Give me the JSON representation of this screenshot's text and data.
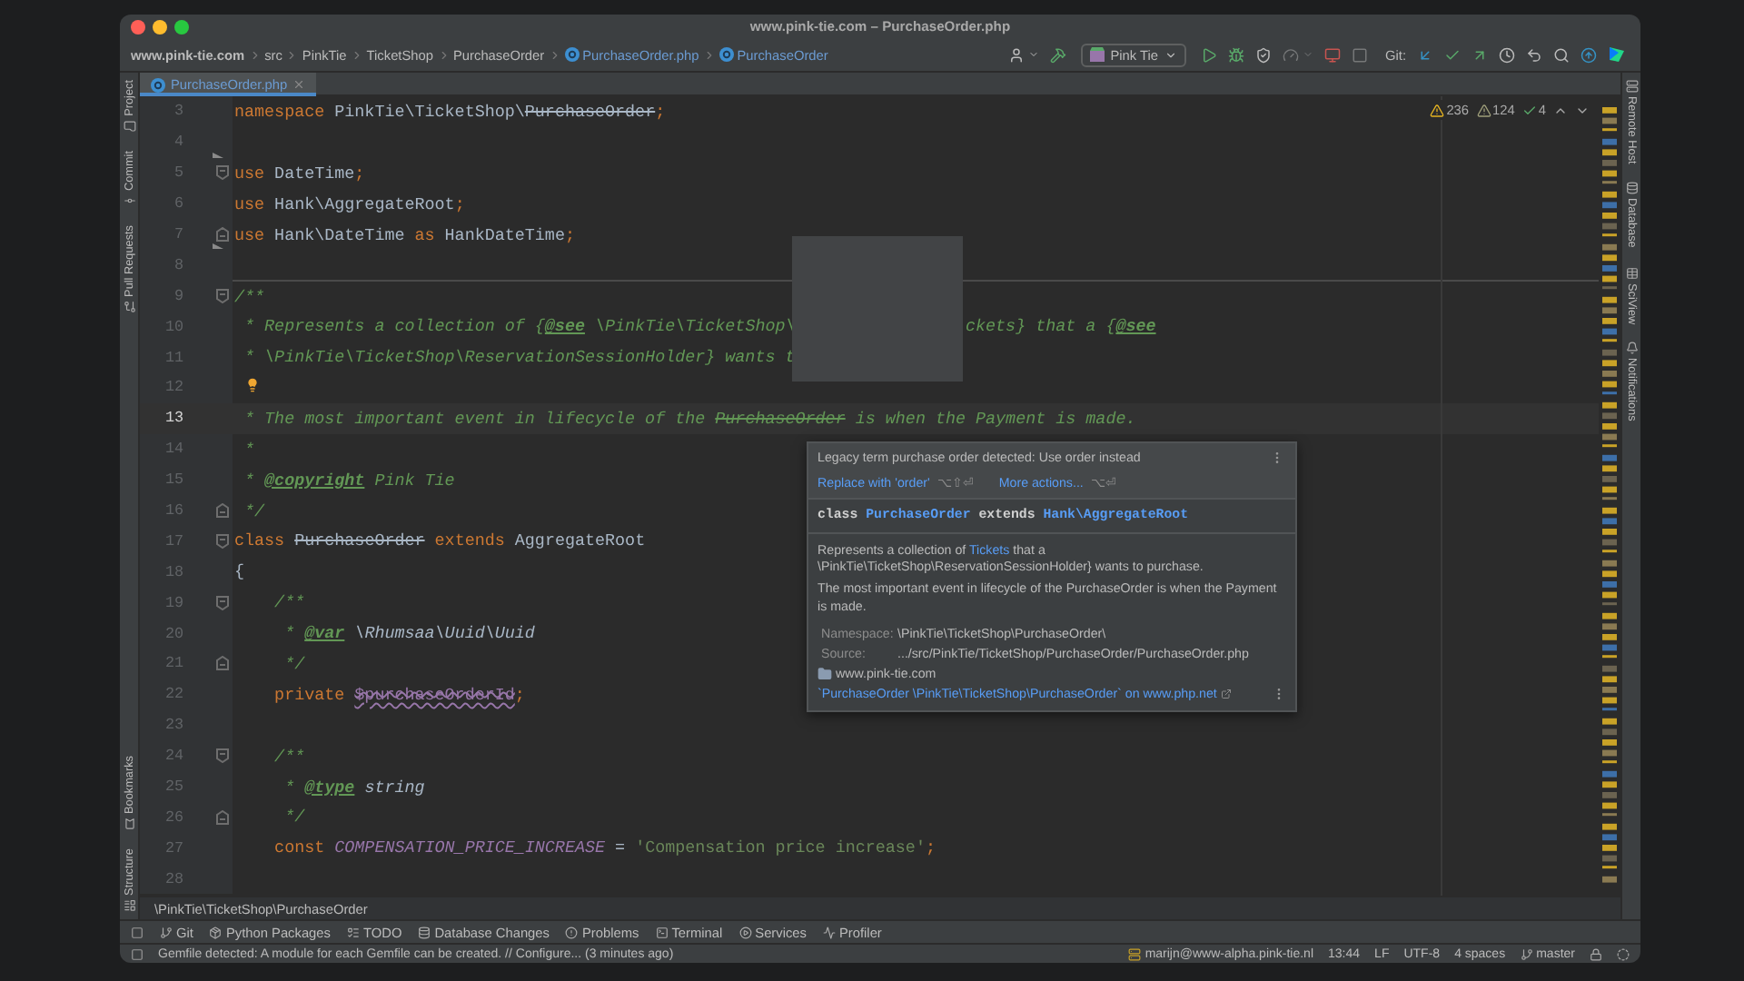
{
  "window": {
    "title": "www.pink-tie.com – PurchaseOrder.php"
  },
  "breadcrumbs": [
    {
      "label": "www.pink-tie.com",
      "kind": "project"
    },
    {
      "label": "src",
      "kind": "folder"
    },
    {
      "label": "PinkTie",
      "kind": "folder"
    },
    {
      "label": "TicketShop",
      "kind": "folder"
    },
    {
      "label": "PurchaseOrder",
      "kind": "folder"
    },
    {
      "label": "PurchaseOrder.php",
      "kind": "class"
    },
    {
      "label": "PurchaseOrder",
      "kind": "class"
    }
  ],
  "toolbar": [
    {
      "kind": "user",
      "disabled": false
    },
    {
      "kind": "build",
      "disabled": false
    },
    {
      "kind": "config",
      "label": "Pink Tie",
      "disabled": false
    },
    {
      "kind": "run",
      "disabled": false
    },
    {
      "kind": "debug",
      "disabled": false
    },
    {
      "kind": "coverage",
      "disabled": false
    },
    {
      "kind": "profile",
      "disabled": true
    },
    {
      "kind": "attach",
      "disabled": false
    },
    {
      "kind": "stop",
      "disabled": true
    },
    {
      "kind": "label",
      "label": "Git:",
      "disabled": false
    },
    {
      "kind": "update",
      "disabled": false
    },
    {
      "kind": "commit",
      "disabled": false
    },
    {
      "kind": "push",
      "disabled": false
    },
    {
      "kind": "history",
      "disabled": false
    },
    {
      "kind": "rollback",
      "disabled": false
    },
    {
      "kind": "search",
      "disabled": false
    },
    {
      "kind": "ide_update",
      "disabled": false
    },
    {
      "kind": "plugin",
      "disabled": false
    }
  ],
  "tabs": [
    {
      "label": "PurchaseOrder.php",
      "selected": true
    }
  ],
  "left_tool_windows": {
    "top": [
      {
        "label": "Project",
        "kind": "project"
      },
      {
        "label": "Commit",
        "kind": "commit"
      },
      {
        "label": "Pull Requests",
        "kind": "pulls"
      }
    ],
    "bottom": [
      {
        "label": "Bookmarks",
        "kind": "bookmarks"
      },
      {
        "label": "Structure",
        "kind": "structure"
      }
    ]
  },
  "right_tool_windows": [
    {
      "label": "Remote Host",
      "kind": "remote"
    },
    {
      "label": "Database",
      "kind": "database"
    },
    {
      "label": "SciView",
      "kind": "sciview"
    },
    {
      "label": "Notifications",
      "kind": "notifications"
    }
  ],
  "inspections": [
    {
      "kind": "warning",
      "count": "236"
    },
    {
      "kind": "weak",
      "count": "124"
    },
    {
      "kind": "typo",
      "count": "4"
    }
  ],
  "code": {
    "lines": [
      {
        "number": "3",
        "tokens": [
          {
            "kind": "kw",
            "text": "namespace"
          },
          {
            "kind": "plain",
            "text": " PinkTie\\TicketShop\\"
          },
          {
            "kind": "strike",
            "text": "PurchaseOrder"
          },
          {
            "kind": "kw",
            "text": ";"
          }
        ]
      },
      {
        "number": "4",
        "marker": true
      },
      {
        "number": "5",
        "fold_start": true,
        "tokens": [
          {
            "kind": "kw",
            "text": "use"
          },
          {
            "kind": "plain",
            "text": " DateTime"
          },
          {
            "kind": "kw",
            "text": ";"
          }
        ]
      },
      {
        "number": "6",
        "tokens": [
          {
            "kind": "kw",
            "text": "use"
          },
          {
            "kind": "plain",
            "text": " Hank\\AggregateRoot"
          },
          {
            "kind": "kw",
            "text": ";"
          }
        ]
      },
      {
        "number": "7",
        "fold_end": true,
        "marker": true,
        "tokens": [
          {
            "kind": "kw",
            "text": "use"
          },
          {
            "kind": "plain",
            "text": " Hank\\DateTime "
          },
          {
            "kind": "kw",
            "text": "as"
          },
          {
            "kind": "plain",
            "text": " HankDateTime"
          },
          {
            "kind": "kw",
            "text": ";"
          }
        ]
      },
      {
        "number": "8"
      },
      {
        "number": "9",
        "fold_start": true,
        "separator_above": true,
        "tokens": [
          {
            "kind": "comment",
            "text": "/**"
          }
        ]
      },
      {
        "number": "10",
        "tokens": [
          {
            "kind": "comment",
            "text": " * Represents a collection of {"
          },
          {
            "kind": "doctag",
            "text": "@see"
          },
          {
            "kind": "comment",
            "text": " \\PinkTie\\TicketShop\\"
          },
          {
            "kind": "covered"
          },
          {
            "kind": "comment",
            "text": "ckets} that a {"
          },
          {
            "kind": "doctag",
            "text": "@see"
          }
        ]
      },
      {
        "number": "11",
        "tokens": [
          {
            "kind": "comment",
            "text": " * \\PinkTie\\TicketShop\\ReservationSessionHolder} wants t"
          }
        ]
      },
      {
        "number": "12",
        "bulb": true
      },
      {
        "number": "13",
        "current": true,
        "tokens": [
          {
            "kind": "comment",
            "text": " * The most important event in lifecycle of the "
          },
          {
            "kind": "commentstrike",
            "text": "PurchaseOrder"
          },
          {
            "kind": "comment",
            "text": " is when the Payment is made."
          }
        ]
      },
      {
        "number": "14",
        "tokens": [
          {
            "kind": "comment",
            "text": " *"
          }
        ]
      },
      {
        "number": "15",
        "tokens": [
          {
            "kind": "comment",
            "text": " * "
          },
          {
            "kind": "doctag",
            "text": "@copyright"
          },
          {
            "kind": "comment",
            "text": " Pink Tie"
          }
        ]
      },
      {
        "number": "16",
        "fold_end": true,
        "tokens": [
          {
            "kind": "comment",
            "text": " */"
          }
        ]
      },
      {
        "number": "17",
        "fold_start": true,
        "tokens": [
          {
            "kind": "kw",
            "text": "class "
          },
          {
            "kind": "strike",
            "text": "PurchaseOrder"
          },
          {
            "kind": "kw",
            "text": " extends"
          },
          {
            "kind": "plain",
            "text": " AggregateRoot"
          }
        ]
      },
      {
        "number": "18",
        "tokens": [
          {
            "kind": "plain",
            "text": "{"
          }
        ]
      },
      {
        "number": "19",
        "fold_start": true,
        "tokens": [
          {
            "kind": "comment",
            "text": "    /**"
          }
        ]
      },
      {
        "number": "20",
        "tokens": [
          {
            "kind": "comment",
            "text": "     * "
          },
          {
            "kind": "doctag",
            "text": "@var"
          },
          {
            "kind": "doctype",
            "text": " \\Rhumsaa\\Uuid\\Uuid"
          }
        ]
      },
      {
        "number": "21",
        "fold_end": true,
        "tokens": [
          {
            "kind": "comment",
            "text": "     */"
          }
        ]
      },
      {
        "number": "22",
        "tokens": [
          {
            "kind": "kw",
            "text": "    private "
          },
          {
            "kind": "var",
            "text": "$purchaseOrderId"
          },
          {
            "kind": "kw",
            "text": ";"
          }
        ]
      },
      {
        "number": "23"
      },
      {
        "number": "24",
        "fold_start": true,
        "tokens": [
          {
            "kind": "comment",
            "text": "    /**"
          }
        ]
      },
      {
        "number": "25",
        "tokens": [
          {
            "kind": "comment",
            "text": "     * "
          },
          {
            "kind": "doctag",
            "text": "@type"
          },
          {
            "kind": "doctype",
            "text": " string"
          }
        ]
      },
      {
        "number": "26",
        "fold_end": true,
        "tokens": [
          {
            "kind": "comment",
            "text": "     */"
          }
        ]
      },
      {
        "number": "27",
        "tokens": [
          {
            "kind": "kw",
            "text": "    const "
          },
          {
            "kind": "const",
            "text": "COMPENSATION_PRICE_INCREASE"
          },
          {
            "kind": "plain",
            "text": " = "
          },
          {
            "kind": "string",
            "text": "'Compensation price increase'"
          },
          {
            "kind": "kw",
            "text": ";"
          }
        ]
      },
      {
        "number": "28"
      }
    ]
  },
  "popup": {
    "problem": "Legacy term purchase order detected: Use order instead",
    "actions": [
      {
        "label": "Replace with 'order'",
        "shortcut": "⌥⇧⏎"
      },
      {
        "label": "More actions...",
        "shortcut": "⌥⏎"
      }
    ],
    "signature": [
      {
        "kind": "kw",
        "text": "class "
      },
      {
        "kind": "link",
        "text": "PurchaseOrder"
      },
      {
        "kind": "kw",
        "text": " extends "
      },
      {
        "kind": "link",
        "text": "Hank\\AggregateRoot"
      }
    ],
    "description": [
      {
        "kind": "text",
        "text": "Represents a collection of "
      },
      {
        "kind": "link",
        "text": "Tickets"
      },
      {
        "kind": "text",
        "text": " that a \\PinkTie\\TicketShop\\ReservationSessionHolder} wants to purchase."
      }
    ],
    "note": "The most important event in lifecycle of the PurchaseOrder is when the Payment is made.",
    "info": [
      {
        "label": "Namespace:",
        "value": "\\PinkTie\\TicketShop\\PurchaseOrder\\"
      },
      {
        "label": "Source:",
        "value": ".../src/PinkTie/TicketShop/PurchaseOrder/PurchaseOrder.php"
      }
    ],
    "site": "www.pink-tie.com",
    "external_link": "`PurchaseOrder \\PinkTie\\TicketShop\\PurchaseOrder` on www.php.net"
  },
  "footer_breadcrumb": "\\PinkTie\\TicketShop\\PurchaseOrder",
  "tool_tabs": [
    {
      "label": "Git",
      "kind": "git"
    },
    {
      "label": "Python Packages",
      "kind": "packages"
    },
    {
      "label": "TODO",
      "kind": "todo"
    },
    {
      "label": "Database Changes",
      "kind": "database"
    },
    {
      "label": "Problems",
      "kind": "problems"
    },
    {
      "label": "Terminal",
      "kind": "terminal"
    },
    {
      "label": "Services",
      "kind": "services"
    },
    {
      "label": "Profiler",
      "kind": "profiler"
    }
  ],
  "status": {
    "message": "Gemfile detected: A module for each Gemfile can be created. // Configure... (3 minutes ago)",
    "items": [
      {
        "label": "marijn@www-alpha.pink-tie.nl",
        "kind": "remote"
      },
      {
        "label": "13:44",
        "kind": "text"
      },
      {
        "label": "LF",
        "kind": "text"
      },
      {
        "label": "UTF-8",
        "kind": "text"
      },
      {
        "label": "4 spaces",
        "kind": "text"
      },
      {
        "label": "master",
        "kind": "branch"
      }
    ]
  }
}
